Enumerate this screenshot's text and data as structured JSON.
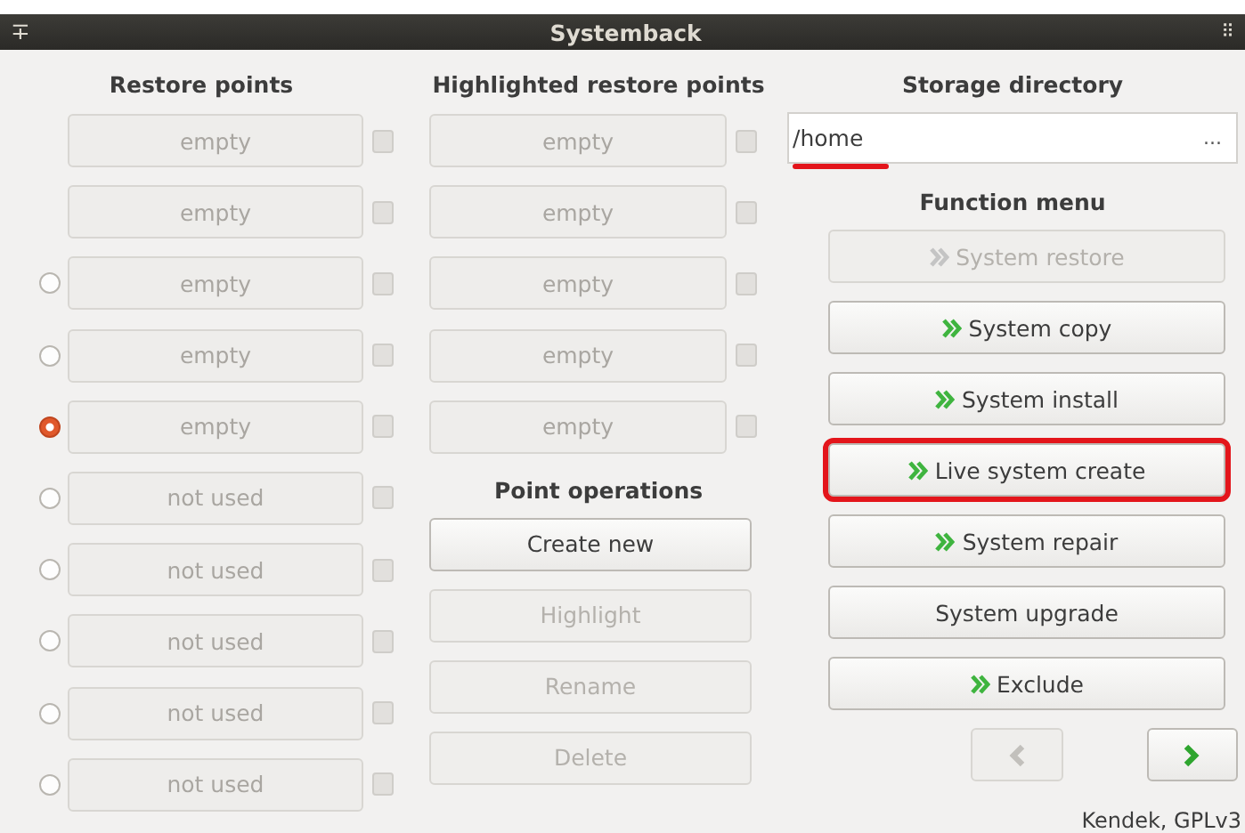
{
  "window": {
    "title": "Systemback",
    "pin_icon": "∓",
    "grip_icon": "⠿"
  },
  "restore_points": {
    "heading": "Restore points",
    "items": [
      {
        "kind": "plain",
        "text": "empty",
        "checked": false
      },
      {
        "kind": "plain",
        "text": "empty",
        "checked": false
      },
      {
        "kind": "radio",
        "text": "empty",
        "selected": false,
        "checked": false
      },
      {
        "kind": "radio",
        "text": "empty",
        "selected": false,
        "checked": false
      },
      {
        "kind": "radio",
        "text": "empty",
        "selected": true,
        "checked": false
      },
      {
        "kind": "radio",
        "text": "not used",
        "selected": false,
        "checked": false
      },
      {
        "kind": "radio",
        "text": "not used",
        "selected": false,
        "checked": false
      },
      {
        "kind": "radio",
        "text": "not used",
        "selected": false,
        "checked": false
      },
      {
        "kind": "radio",
        "text": "not used",
        "selected": false,
        "checked": false
      },
      {
        "kind": "radio",
        "text": "not used",
        "selected": false,
        "checked": false
      }
    ]
  },
  "highlighted_restore_points": {
    "heading": "Highlighted restore points",
    "items": [
      {
        "text": "empty",
        "checked": false
      },
      {
        "text": "empty",
        "checked": false
      },
      {
        "text": "empty",
        "checked": false
      },
      {
        "text": "empty",
        "checked": false
      },
      {
        "text": "empty",
        "checked": false
      }
    ]
  },
  "point_operations": {
    "heading": "Point operations",
    "buttons": [
      {
        "label": "Create new",
        "disabled": false
      },
      {
        "label": "Highlight",
        "disabled": true
      },
      {
        "label": "Rename",
        "disabled": true
      },
      {
        "label": "Delete",
        "disabled": true
      }
    ]
  },
  "storage_directory": {
    "heading": "Storage directory",
    "value": "/home",
    "browse": "...",
    "underlined": true
  },
  "function_menu": {
    "heading": "Function menu",
    "buttons": [
      {
        "label": "System restore",
        "arrow": true,
        "disabled": true,
        "outlined": false
      },
      {
        "label": "System copy",
        "arrow": true,
        "disabled": false,
        "outlined": false
      },
      {
        "label": "System install",
        "arrow": true,
        "disabled": false,
        "outlined": false
      },
      {
        "label": "Live system create",
        "arrow": true,
        "disabled": false,
        "outlined": true
      },
      {
        "label": "System repair",
        "arrow": true,
        "disabled": false,
        "outlined": false
      },
      {
        "label": "System upgrade",
        "arrow": false,
        "disabled": false,
        "outlined": false
      },
      {
        "label": "Exclude",
        "arrow": true,
        "disabled": false,
        "outlined": false
      }
    ]
  },
  "navigation": [
    {
      "kind": "back",
      "disabled": true
    },
    {
      "kind": "next",
      "disabled": false
    }
  ],
  "footer": "Kendek, GPLv3"
}
